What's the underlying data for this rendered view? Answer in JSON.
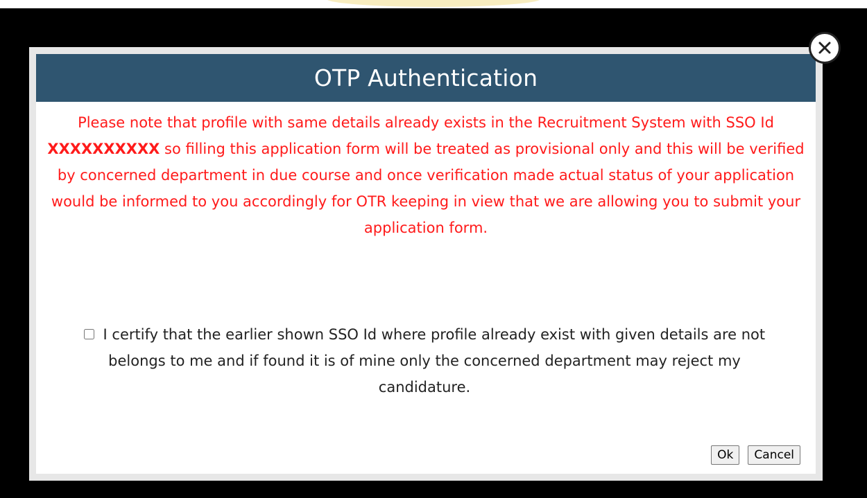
{
  "modal": {
    "title": "OTP Authentication",
    "notice_before_id": "Please note that profile with same details already exists in the Recruitment System with SSO Id ",
    "sso_id": "XXXXXXXXXX",
    "notice_after_id": " so filling this application form will be treated as provisional only and this will be verified by concerned department in due course and once verification made actual status of your application would be informed to you accordingly for OTR keeping in view that we are allowing you to submit your application form.",
    "certify_label": "I certify that the earlier shown SSO Id where profile already exist with given details are not belongs to me and if found it is of mine only the concerned department may reject my candidature.",
    "certify_checked": false,
    "ok_label": "Ok",
    "cancel_label": "Cancel"
  },
  "icons": {
    "close": "close-icon"
  },
  "colors": {
    "header_bg": "#2f5570",
    "notice_text": "#ff1a1a",
    "overlay": "#000000"
  }
}
